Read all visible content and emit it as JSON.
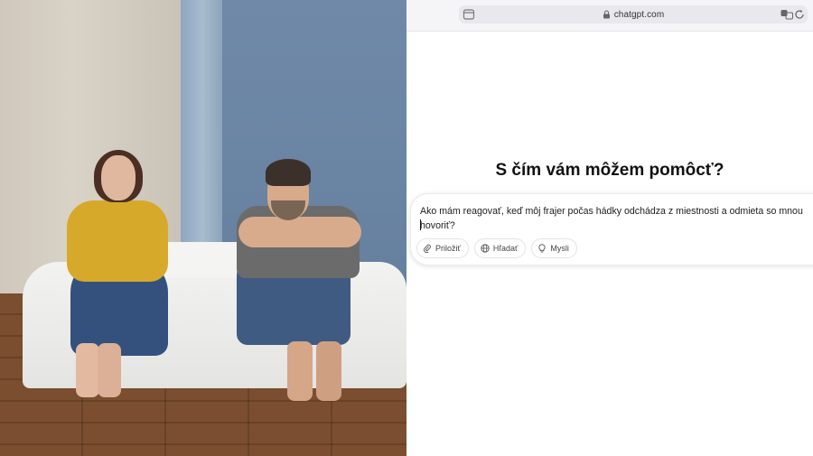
{
  "photo": {
    "alt_tag": "couple-sitting-apart-photo"
  },
  "browser": {
    "url": "chatgpt.com",
    "icons": {
      "sidebar": "sidebar-icon",
      "lock": "lock-icon",
      "translate": "translate-icon",
      "reload": "reload-icon"
    }
  },
  "chat": {
    "headline": "S čím vám môžem pomôcť?",
    "input_value_line1": "Ako mám reagovať, keď môj frajer počas hádky odchádza z miestnosti a odmieta so mnou",
    "input_value_line2": "hovoriť?",
    "chips": [
      {
        "label": "Priložiť",
        "icon": "paperclip-icon"
      },
      {
        "label": "Hľadať",
        "icon": "globe-icon"
      },
      {
        "label": "Mysli",
        "icon": "lightbulb-icon"
      }
    ]
  }
}
